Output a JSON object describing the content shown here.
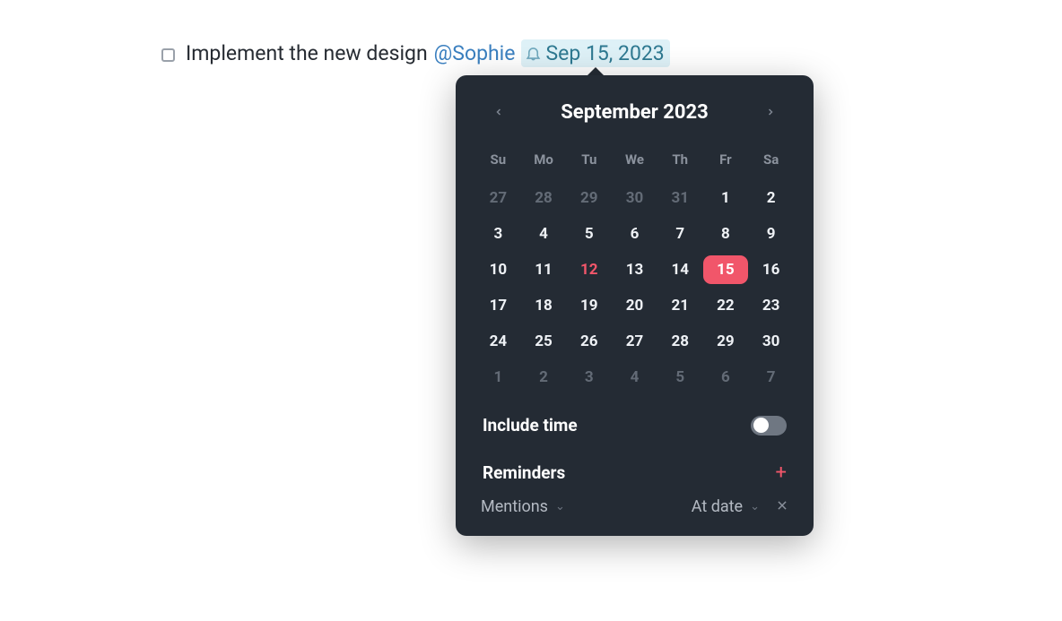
{
  "task": {
    "text": "Implement the new design",
    "mention": "@Sophie",
    "date_label": "Sep 15, 2023"
  },
  "calendar": {
    "title": "September 2023",
    "dow": [
      "Su",
      "Mo",
      "Tu",
      "We",
      "Th",
      "Fr",
      "Sa"
    ],
    "days": [
      {
        "n": "27",
        "cls": "other"
      },
      {
        "n": "28",
        "cls": "other"
      },
      {
        "n": "29",
        "cls": "other"
      },
      {
        "n": "30",
        "cls": "other"
      },
      {
        "n": "31",
        "cls": "other"
      },
      {
        "n": "1",
        "cls": ""
      },
      {
        "n": "2",
        "cls": ""
      },
      {
        "n": "3",
        "cls": ""
      },
      {
        "n": "4",
        "cls": ""
      },
      {
        "n": "5",
        "cls": ""
      },
      {
        "n": "6",
        "cls": ""
      },
      {
        "n": "7",
        "cls": ""
      },
      {
        "n": "8",
        "cls": ""
      },
      {
        "n": "9",
        "cls": ""
      },
      {
        "n": "10",
        "cls": ""
      },
      {
        "n": "11",
        "cls": ""
      },
      {
        "n": "12",
        "cls": "today"
      },
      {
        "n": "13",
        "cls": ""
      },
      {
        "n": "14",
        "cls": ""
      },
      {
        "n": "15",
        "cls": "selected"
      },
      {
        "n": "16",
        "cls": ""
      },
      {
        "n": "17",
        "cls": ""
      },
      {
        "n": "18",
        "cls": ""
      },
      {
        "n": "19",
        "cls": ""
      },
      {
        "n": "20",
        "cls": ""
      },
      {
        "n": "21",
        "cls": ""
      },
      {
        "n": "22",
        "cls": ""
      },
      {
        "n": "23",
        "cls": ""
      },
      {
        "n": "24",
        "cls": ""
      },
      {
        "n": "25",
        "cls": ""
      },
      {
        "n": "26",
        "cls": ""
      },
      {
        "n": "27",
        "cls": ""
      },
      {
        "n": "28",
        "cls": ""
      },
      {
        "n": "29",
        "cls": ""
      },
      {
        "n": "30",
        "cls": ""
      },
      {
        "n": "1",
        "cls": "other"
      },
      {
        "n": "2",
        "cls": "other"
      },
      {
        "n": "3",
        "cls": "other"
      },
      {
        "n": "4",
        "cls": "other"
      },
      {
        "n": "5",
        "cls": "other"
      },
      {
        "n": "6",
        "cls": "other"
      },
      {
        "n": "7",
        "cls": "other"
      }
    ]
  },
  "options": {
    "include_time_label": "Include time",
    "include_time_on": false,
    "reminders_label": "Reminders",
    "reminder_type": "Mentions",
    "reminder_when": "At date"
  }
}
